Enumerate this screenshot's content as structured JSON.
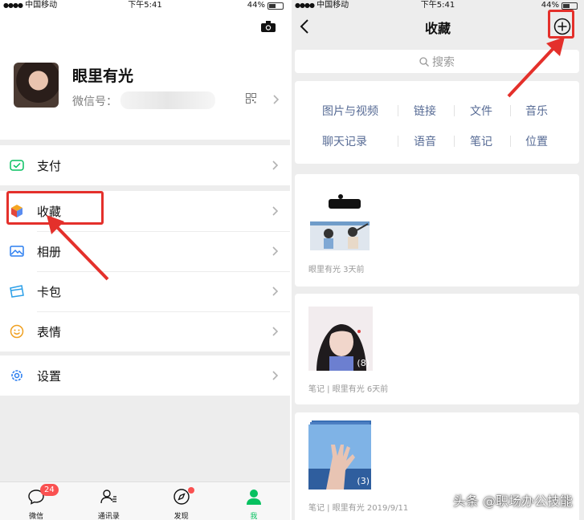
{
  "left": {
    "status": {
      "carrier": "中国移动",
      "time": "下午5:41",
      "battery": "44%"
    },
    "profile": {
      "nickname": "眼里有光",
      "wechat_id_label": "微信号：",
      "wechat_id_value": ""
    },
    "menu": [
      {
        "label": "支付",
        "icon": "payment-icon"
      },
      {
        "label": "收藏",
        "icon": "favorites-cube-icon"
      },
      {
        "label": "相册",
        "icon": "album-icon"
      },
      {
        "label": "卡包",
        "icon": "card-wallet-icon"
      },
      {
        "label": "表情",
        "icon": "emoji-icon"
      },
      {
        "label": "设置",
        "icon": "gear-icon"
      }
    ],
    "tabs": [
      {
        "label": "微信",
        "badge": "24"
      },
      {
        "label": "通讯录"
      },
      {
        "label": "发现"
      },
      {
        "label": "我"
      }
    ]
  },
  "right": {
    "status": {
      "carrier": "中国移动",
      "time": "下午5:41",
      "battery": "44%"
    },
    "title": "收藏",
    "search_placeholder": "搜索",
    "categories": [
      "图片与视频",
      "链接",
      "文件",
      "音乐",
      "聊天记录",
      "语音",
      "笔记",
      "位置"
    ],
    "items": [
      {
        "meta": "眼里有光   3天前"
      },
      {
        "meta": "笔记  |  眼里有光   6天前",
        "count": "(8)"
      },
      {
        "meta": "笔记  |  眼里有光   2019/9/11",
        "count": "(3)"
      }
    ]
  },
  "watermark": "头条 @职场办公技能",
  "colors": {
    "accent_green": "#07c160",
    "link_blue": "#576b95",
    "highlight_red": "#e4302b",
    "badge_red": "#fa5151"
  }
}
